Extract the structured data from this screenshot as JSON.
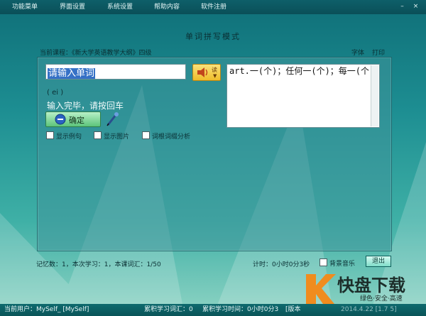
{
  "menubar": {
    "items": [
      "功能菜单",
      "界面设置",
      "系统设置",
      "帮助内容",
      "软件注册"
    ],
    "minimize": "–",
    "close": "×"
  },
  "header": {
    "title": "单词拼写模式",
    "course_label": "当前课程：《新大学英语教学大纲》四级",
    "font_link": "字体",
    "print_link": "打印"
  },
  "main": {
    "word_input": {
      "value": "请输入单词"
    },
    "speaker_label": "读",
    "definition": "art.一(个)；任何一(个)；每一(个)",
    "phonetic": "( ei )",
    "hint": "输入完毕，请按回车",
    "ok_button": "确定",
    "options": [
      {
        "label": "显示例句",
        "checked": false
      },
      {
        "label": "显示图片",
        "checked": false
      },
      {
        "label": "词根词缀分析",
        "checked": false
      }
    ]
  },
  "status": {
    "progress": "记忆数：1，本次学习：1，本课词汇：1/50",
    "timer": "计时：0小时0分3秒",
    "bg_music": "背景音乐",
    "exit": "退出"
  },
  "bottombar": {
    "user": "当前用户：MySelf_ [MySelf]",
    "total_words": "累积学习词汇：0",
    "total_time": "累积学习时间：0小时0分3",
    "version": "[版本",
    "date_fragment": "2014.4.22  [1.7 5]"
  },
  "watermark": {
    "text_main": "快盘下载",
    "text_sub": "绿色·安全·高速",
    "accent": "#f08c1e"
  }
}
